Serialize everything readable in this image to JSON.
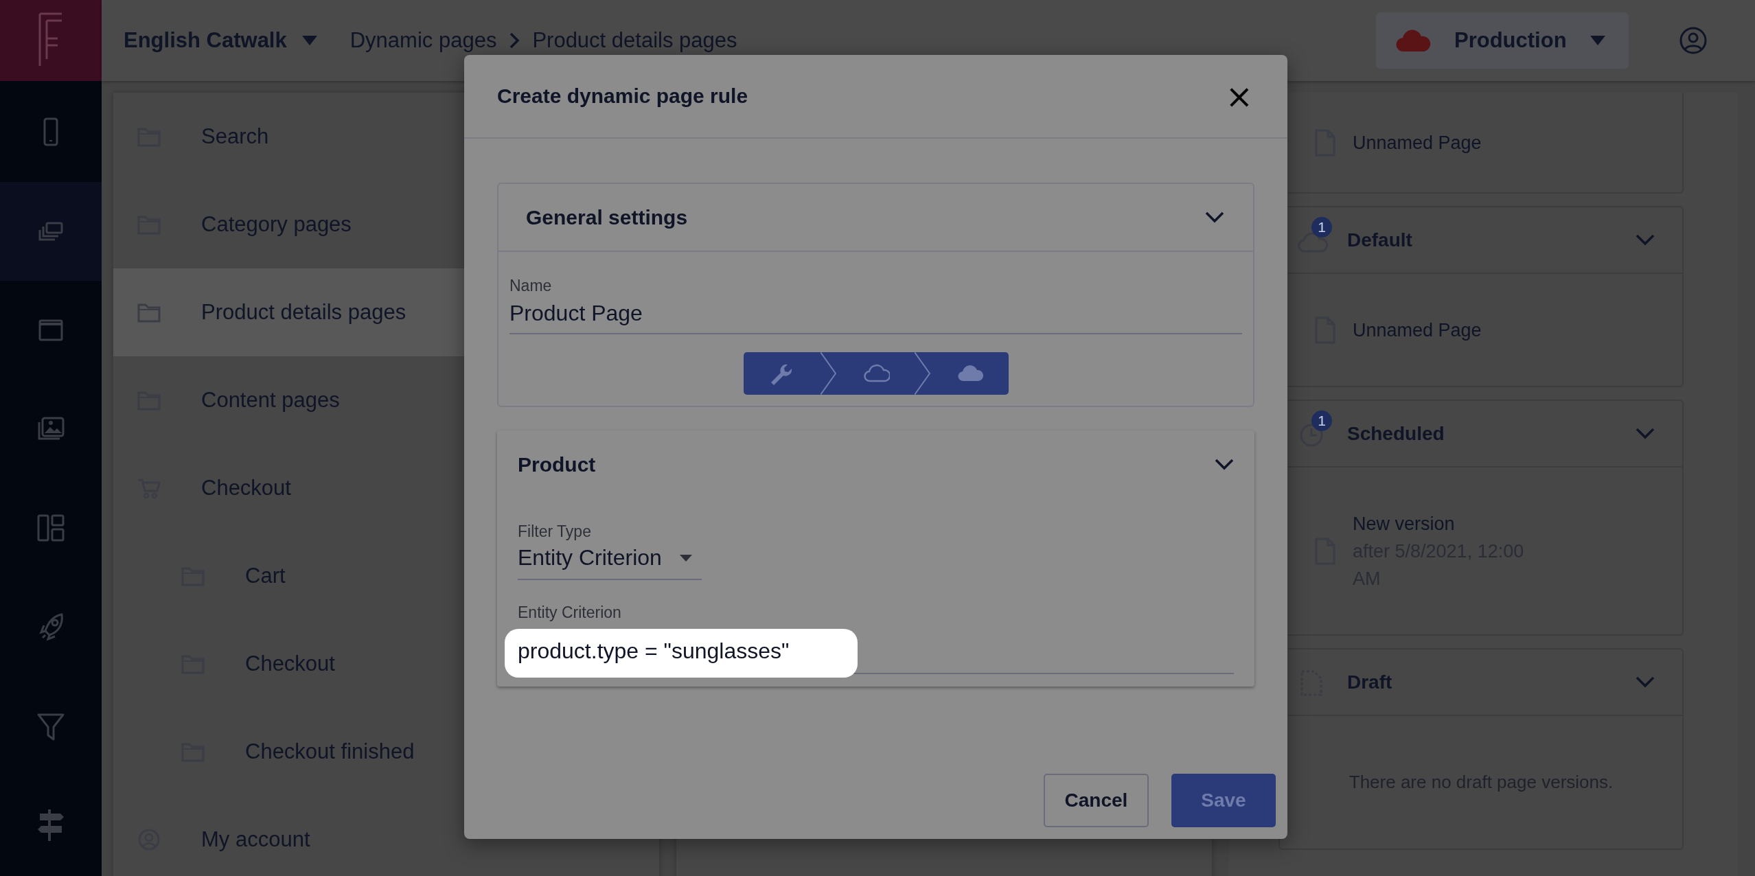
{
  "rail": {
    "items": [
      {
        "selected": false
      },
      {
        "selected": true
      },
      {
        "selected": false
      },
      {
        "selected": false
      },
      {
        "selected": false
      },
      {
        "selected": false
      },
      {
        "selected": false
      },
      {
        "selected": false
      }
    ]
  },
  "topbar": {
    "site": "English Catwalk",
    "breadcrumbs": [
      "Dynamic pages",
      "Product details pages"
    ],
    "environment": "Production"
  },
  "page_list": [
    {
      "label": "Search",
      "kind": "folder",
      "selected": false
    },
    {
      "label": "Category pages",
      "kind": "folder",
      "selected": false
    },
    {
      "label": "Product details pages",
      "kind": "folder",
      "selected": true
    },
    {
      "label": "Content pages",
      "kind": "folder",
      "selected": false
    },
    {
      "label": "Checkout",
      "kind": "cart",
      "selected": false,
      "children": [
        {
          "label": "Cart",
          "kind": "folder",
          "selected": false
        },
        {
          "label": "Checkout",
          "kind": "folder",
          "selected": false
        },
        {
          "label": "Checkout finished",
          "kind": "folder",
          "selected": false
        }
      ]
    },
    {
      "label": "My account",
      "kind": "account",
      "selected": false
    }
  ],
  "version_cards": [
    {
      "kind": "plain",
      "pages": [
        {
          "title": "Unnamed Page"
        }
      ]
    },
    {
      "kind": "default",
      "title": "Default",
      "badge": "1",
      "pages": [
        {
          "title": "Unnamed Page"
        }
      ]
    },
    {
      "kind": "scheduled",
      "title": "Scheduled",
      "badge": "1",
      "pages": [
        {
          "title": "New version",
          "subtitle": "after 5/8/2021, 12:00 AM"
        }
      ]
    },
    {
      "kind": "draft",
      "title": "Draft",
      "empty_text": "There are no draft page versions."
    }
  ],
  "modal": {
    "title": "Create dynamic page rule",
    "close": "×",
    "general": {
      "title": "General settings",
      "name_label": "Name",
      "name_value": "Product Page"
    },
    "product": {
      "title": "Product",
      "filter_label": "Filter Type",
      "filter_value": "Entity Criterion",
      "criterion_label": "Entity Criterion",
      "criterion_value": "product.type = \"sunglasses\""
    },
    "buttons": [
      {
        "label": "Cancel",
        "kind": "secondary"
      },
      {
        "label": "Save",
        "kind": "primary"
      }
    ]
  }
}
